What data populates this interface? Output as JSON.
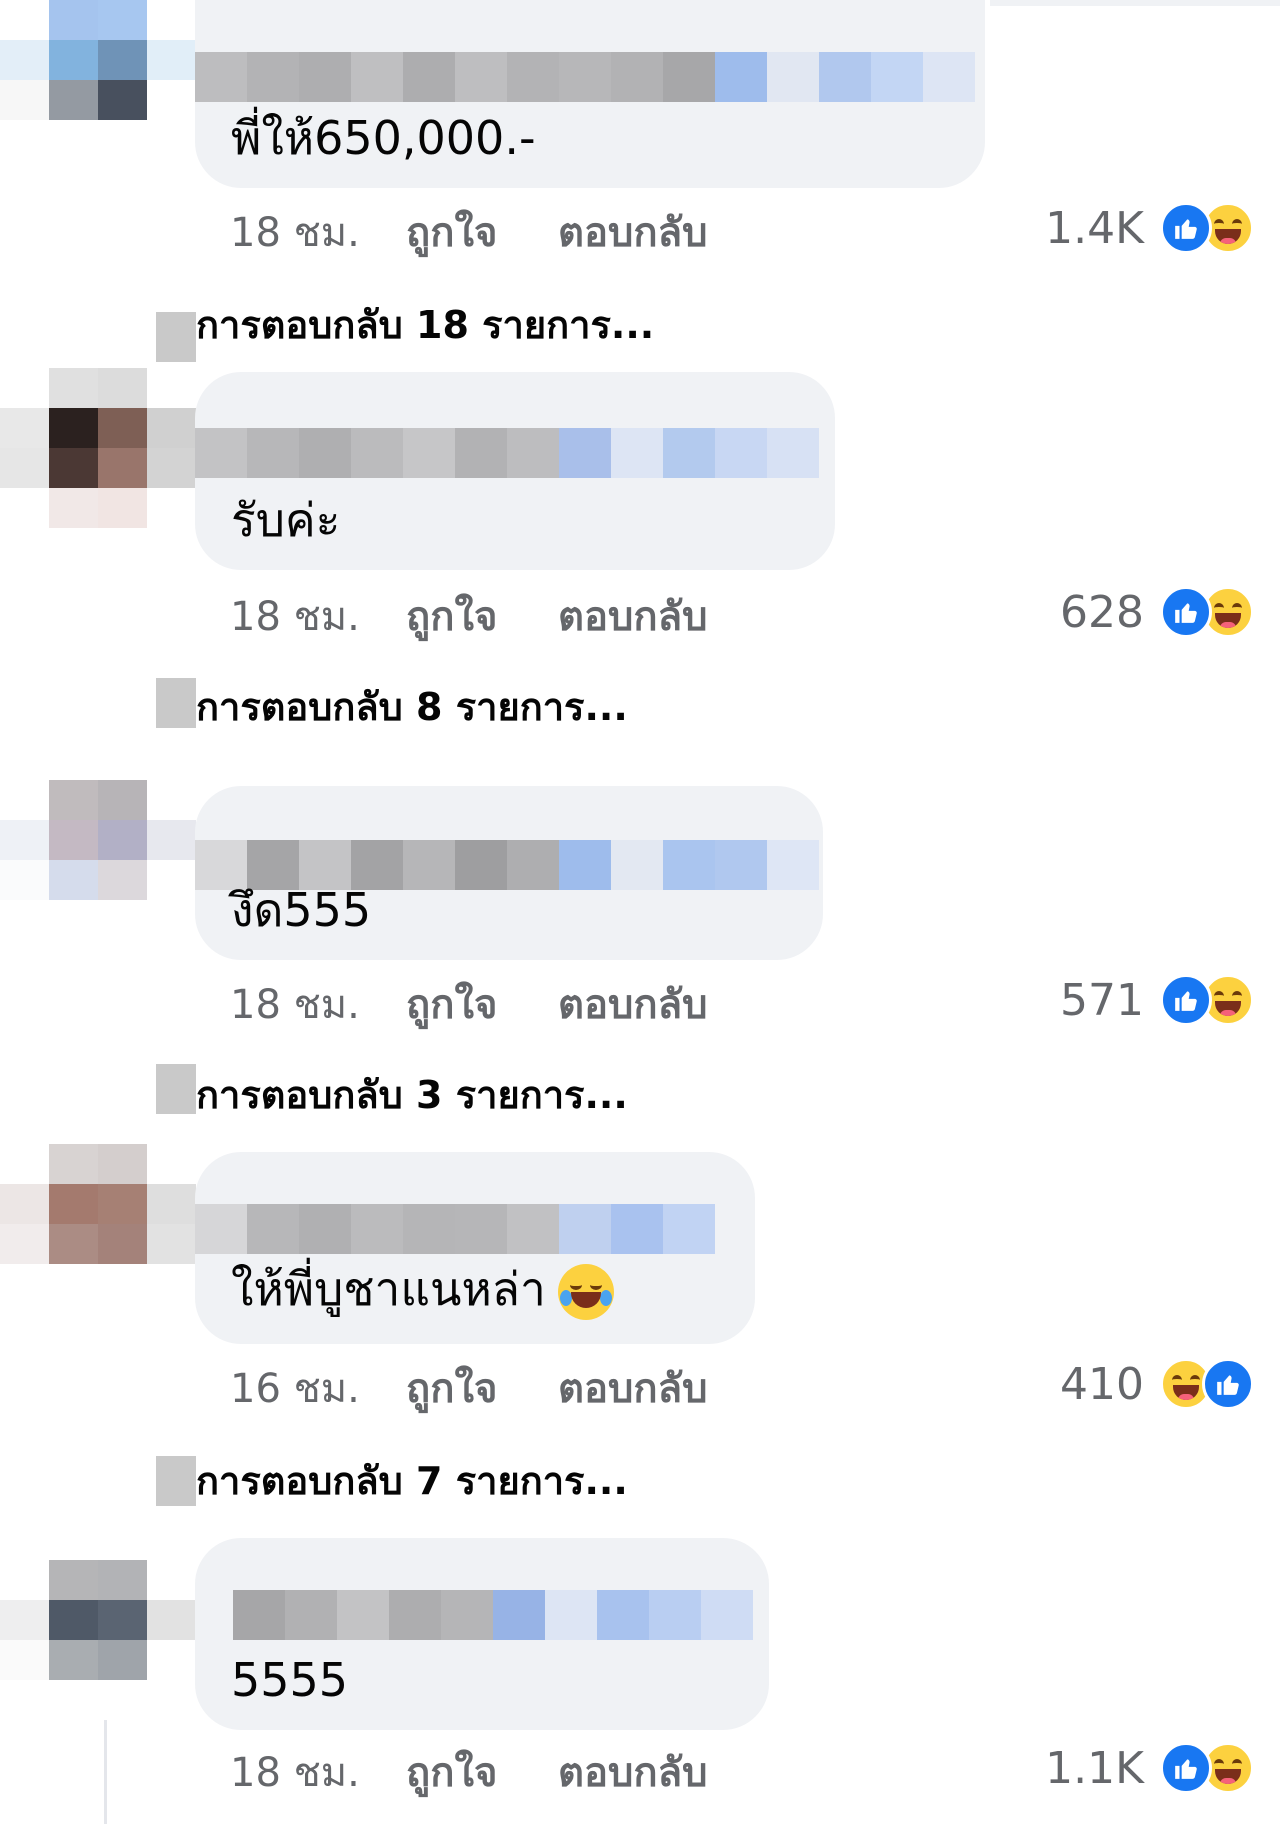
{
  "comments": [
    {
      "text": "พี่ให้650,000.-",
      "time": "18 ชม.",
      "like_label": "ถูกใจ",
      "reply_label": "ตอบกลับ",
      "reaction_count": "1.4K",
      "replies_label": "การตอบกลับ 18 รายการ..."
    },
    {
      "text": "รับค่ะ",
      "time": "18 ชม.",
      "like_label": "ถูกใจ",
      "reply_label": "ตอบกลับ",
      "reaction_count": "628",
      "replies_label": "การตอบกลับ 8 รายการ..."
    },
    {
      "text": "งึด555",
      "time": "18 ชม.",
      "like_label": "ถูกใจ",
      "reply_label": "ตอบกลับ",
      "reaction_count": "571",
      "replies_label": "การตอบกลับ 3 รายการ..."
    },
    {
      "text": "ให้พี่บูชาแนหล่า",
      "time": "16 ชม.",
      "like_label": "ถูกใจ",
      "reply_label": "ตอบกลับ",
      "reaction_count": "410",
      "replies_label": "การตอบกลับ 7 รายการ..."
    },
    {
      "text": "5555",
      "time": "18 ชม.",
      "like_label": "ถูกใจ",
      "reply_label": "ตอบกลับ",
      "reaction_count": "1.1K"
    }
  ],
  "icons": {
    "like": "like-icon",
    "haha": "haha-icon",
    "laugh_emoji": "tears-of-joy-emoji"
  },
  "colors": {
    "bubble": "#f0f2f5",
    "meta_text": "#65676b",
    "like_blue": "#1877f2",
    "haha_yellow": "#fcd13f"
  }
}
